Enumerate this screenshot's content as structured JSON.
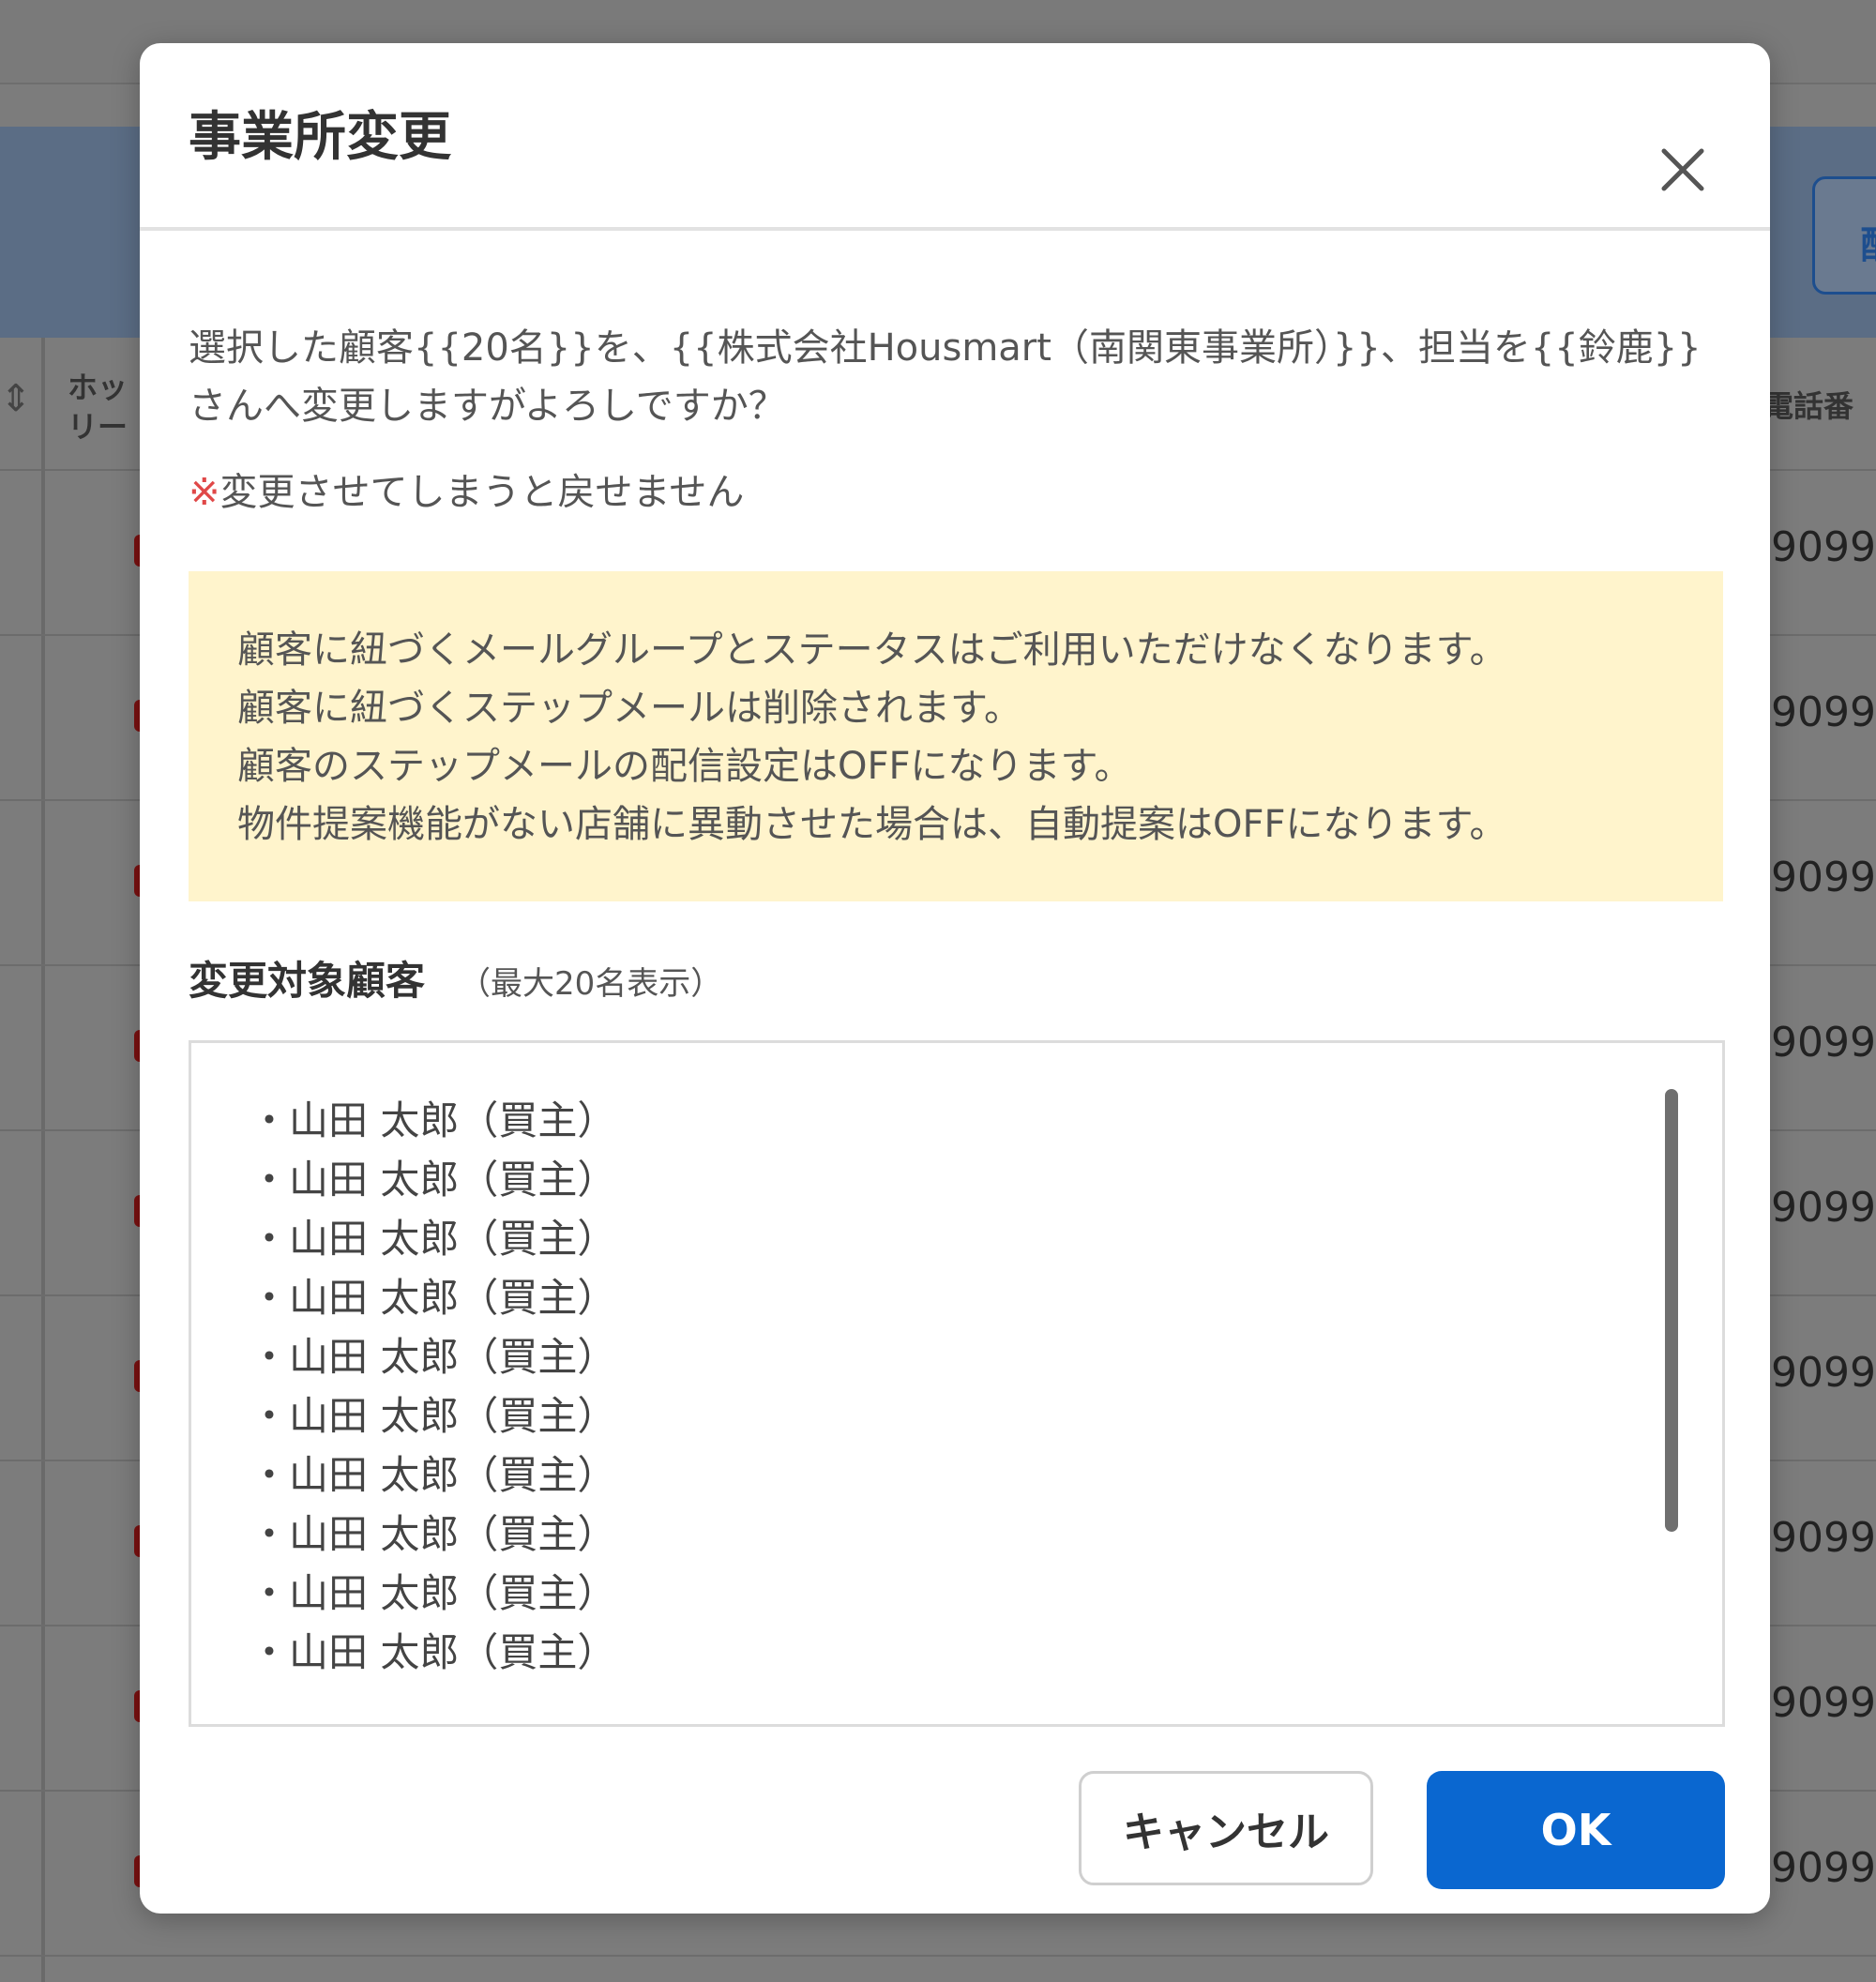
{
  "background": {
    "table_header_col1": "ホッ\nリー",
    "table_header_phone": "電話番",
    "header_button_glyph": "配",
    "phone_values": [
      "9099",
      "9099",
      "9099",
      "9099",
      "9099",
      "9099",
      "9099",
      "9099",
      "9099"
    ]
  },
  "modal": {
    "title": "事業所変更",
    "message": "選択した顧客{{20名}}を、{{株式会社Housmart（南関東事業所）}}、担当を{{鈴鹿}}さんへ変更しますがよろしですか？",
    "warning_mark": "※",
    "warning_text": "変更させてしまうと戻せません",
    "notices": [
      "顧客に紐づくメールグループとステータスはご利用いただけなくなります。",
      "顧客に紐づくステップメールは削除されます。",
      "顧客のステップメールの配信設定はOFFになります。",
      "物件提案機能がない店舗に異動させた場合は、自動提案はOFFになります。"
    ],
    "target_label": "変更対象顧客",
    "target_note": "（最大20名表示）",
    "customers": [
      "・山田 太郎（買主）",
      "・山田 太郎（買主）",
      "・山田 太郎（買主）",
      "・山田 太郎（買主）",
      "・山田 太郎（買主）",
      "・山田 太郎（買主）",
      "・山田 太郎（買主）",
      "・山田 太郎（買主）",
      "・山田 太郎（買主）",
      "・山田 太郎（買主）"
    ],
    "cancel_label": "キャンセル",
    "ok_label": "OK"
  },
  "colors": {
    "primary": "#0a67d0",
    "notice_bg": "#fff4cc",
    "warning": "#e04848"
  }
}
